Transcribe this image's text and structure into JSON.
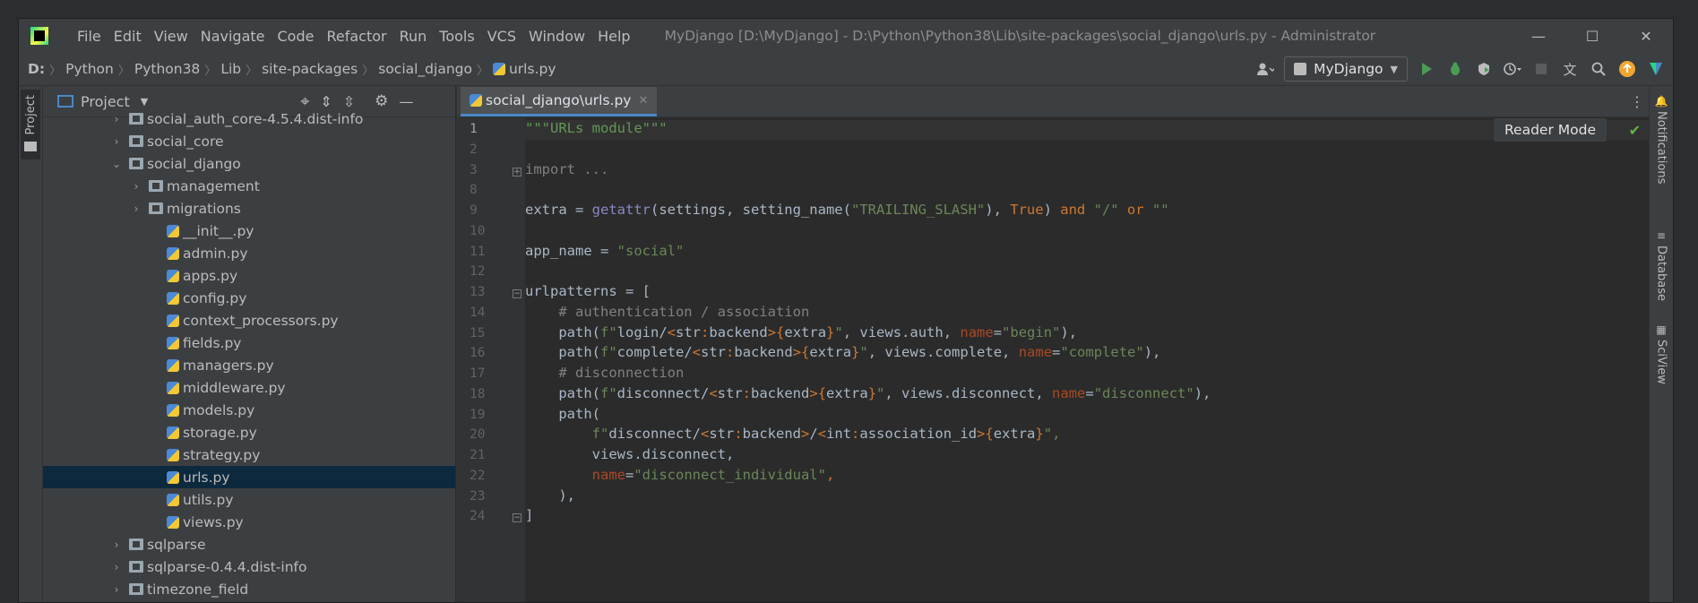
{
  "titlebar": {
    "menu": [
      "File",
      "Edit",
      "View",
      "Navigate",
      "Code",
      "Refactor",
      "Run",
      "Tools",
      "VCS",
      "Window",
      "Help"
    ],
    "window_title": "MyDjango [D:\\MyDjango] - D:\\Python\\Python38\\Lib\\site-packages\\social_django\\urls.py - Administrator",
    "minimize": "—",
    "maximize": "☐",
    "close": "✕"
  },
  "navbar": {
    "crumbs": [
      "D:",
      "Python",
      "Python38",
      "Lib",
      "site-packages",
      "social_django",
      "urls.py"
    ],
    "separator": "〉",
    "run_config": "MyDjango"
  },
  "left_strip": {
    "project_tab": "Project"
  },
  "right_strip": {
    "notifications": "Notifications",
    "database": "Database",
    "sciview": "SciView"
  },
  "project_panel": {
    "title": "Project",
    "tree": [
      {
        "label": "social_auth_core-4.5.4.dist-info",
        "type": "folder",
        "expand": "›"
      },
      {
        "label": "social_core",
        "type": "folder",
        "expand": "›"
      },
      {
        "label": "social_django",
        "type": "folder",
        "expand": "⌄"
      },
      {
        "label": "management",
        "type": "folder",
        "expand": "›"
      },
      {
        "label": "migrations",
        "type": "folder",
        "expand": "›"
      },
      {
        "label": "__init__.py",
        "type": "py"
      },
      {
        "label": "admin.py",
        "type": "py"
      },
      {
        "label": "apps.py",
        "type": "py"
      },
      {
        "label": "config.py",
        "type": "py"
      },
      {
        "label": "context_processors.py",
        "type": "py"
      },
      {
        "label": "fields.py",
        "type": "py"
      },
      {
        "label": "managers.py",
        "type": "py"
      },
      {
        "label": "middleware.py",
        "type": "py"
      },
      {
        "label": "models.py",
        "type": "py"
      },
      {
        "label": "storage.py",
        "type": "py"
      },
      {
        "label": "strategy.py",
        "type": "py"
      },
      {
        "label": "urls.py",
        "type": "py",
        "selected": true
      },
      {
        "label": "utils.py",
        "type": "py"
      },
      {
        "label": "views.py",
        "type": "py"
      },
      {
        "label": "sqlparse",
        "type": "folder",
        "expand": "›"
      },
      {
        "label": "sqlparse-0.4.4.dist-info",
        "type": "folder",
        "expand": "›"
      },
      {
        "label": "timezone_field",
        "type": "folder",
        "expand": "›"
      }
    ]
  },
  "editor": {
    "tab_label": "social_django\\urls.py",
    "tab_close": "✕",
    "reader_mode": "Reader Mode",
    "lines": [
      {
        "num": "1",
        "segments": [
          [
            "\"\"\"URLs module\"\"\"",
            "#629755"
          ]
        ]
      },
      {
        "num": "2",
        "segments": []
      },
      {
        "num": "3",
        "segments": [
          [
            "import ...",
            "#808080"
          ]
        ]
      },
      {
        "num": "8",
        "segments": []
      },
      {
        "num": "9",
        "segments": [
          [
            "extra = ",
            "#a9b7c6"
          ],
          [
            "getattr",
            "#8888c6"
          ],
          [
            "(settings, setting_name(",
            "#a9b7c6"
          ],
          [
            "\"TRAILING_SLASH\"",
            "#6a8759"
          ],
          [
            "), ",
            "#a9b7c6"
          ],
          [
            "True",
            "#cc7832"
          ],
          [
            ") ",
            "#a9b7c6"
          ],
          [
            "and ",
            "#cc7832"
          ],
          [
            "\"/\" ",
            "#6a8759"
          ],
          [
            "or ",
            "#cc7832"
          ],
          [
            "\"\"",
            "#6a8759"
          ]
        ]
      },
      {
        "num": "10",
        "segments": []
      },
      {
        "num": "11",
        "segments": [
          [
            "app_name = ",
            "#a9b7c6"
          ],
          [
            "\"social\"",
            "#6a8759"
          ]
        ]
      },
      {
        "num": "12",
        "segments": []
      },
      {
        "num": "13",
        "segments": [
          [
            "urlpatterns = [",
            "#a9b7c6"
          ]
        ]
      },
      {
        "num": "14",
        "segments": [
          [
            "    # authentication / association",
            "#808080"
          ]
        ]
      },
      {
        "num": "15",
        "segments": [
          [
            "    path(",
            "#a9b7c6"
          ],
          [
            "f\"",
            "#6a8759"
          ],
          [
            "login/",
            "#a9b7c6"
          ],
          [
            "<",
            "#cc7832"
          ],
          [
            "str",
            "#a9b7c6"
          ],
          [
            ":",
            "#cc7832"
          ],
          [
            "backend",
            "#a9b7c6"
          ],
          [
            ">",
            "#cc7832"
          ],
          [
            "{",
            "#cc7832"
          ],
          [
            "extra",
            "#a9b7c6"
          ],
          [
            "}",
            "#cc7832"
          ],
          [
            "\"",
            "#6a8759"
          ],
          [
            ", views.auth, ",
            "#a9b7c6"
          ],
          [
            "name",
            "#aa4926"
          ],
          [
            "=",
            "#a9b7c6"
          ],
          [
            "\"begin\"",
            "#6a8759"
          ],
          [
            "),",
            "#a9b7c6"
          ]
        ]
      },
      {
        "num": "16",
        "segments": [
          [
            "    path(",
            "#a9b7c6"
          ],
          [
            "f\"",
            "#6a8759"
          ],
          [
            "complete/",
            "#a9b7c6"
          ],
          [
            "<",
            "#cc7832"
          ],
          [
            "str",
            "#a9b7c6"
          ],
          [
            ":",
            "#cc7832"
          ],
          [
            "backend",
            "#a9b7c6"
          ],
          [
            ">",
            "#cc7832"
          ],
          [
            "{",
            "#cc7832"
          ],
          [
            "extra",
            "#a9b7c6"
          ],
          [
            "}",
            "#cc7832"
          ],
          [
            "\"",
            "#6a8759"
          ],
          [
            ", views.complete, ",
            "#a9b7c6"
          ],
          [
            "name",
            "#aa4926"
          ],
          [
            "=",
            "#a9b7c6"
          ],
          [
            "\"complete\"",
            "#6a8759"
          ],
          [
            "),",
            "#a9b7c6"
          ]
        ]
      },
      {
        "num": "17",
        "segments": [
          [
            "    # disconnection",
            "#808080"
          ]
        ]
      },
      {
        "num": "18",
        "segments": [
          [
            "    path(",
            "#a9b7c6"
          ],
          [
            "f\"",
            "#6a8759"
          ],
          [
            "disconnect/",
            "#a9b7c6"
          ],
          [
            "<",
            "#cc7832"
          ],
          [
            "str",
            "#a9b7c6"
          ],
          [
            ":",
            "#cc7832"
          ],
          [
            "backend",
            "#a9b7c6"
          ],
          [
            ">",
            "#cc7832"
          ],
          [
            "{",
            "#cc7832"
          ],
          [
            "extra",
            "#a9b7c6"
          ],
          [
            "}",
            "#cc7832"
          ],
          [
            "\"",
            "#6a8759"
          ],
          [
            ", views.disconnect, ",
            "#a9b7c6"
          ],
          [
            "name",
            "#aa4926"
          ],
          [
            "=",
            "#a9b7c6"
          ],
          [
            "\"disconnect\"",
            "#6a8759"
          ],
          [
            "),",
            "#a9b7c6"
          ]
        ]
      },
      {
        "num": "19",
        "segments": [
          [
            "    path(",
            "#a9b7c6"
          ]
        ]
      },
      {
        "num": "20",
        "segments": [
          [
            "        ",
            "#a9b7c6"
          ],
          [
            "f\"",
            "#6a8759"
          ],
          [
            "disconnect/",
            "#a9b7c6"
          ],
          [
            "<",
            "#cc7832"
          ],
          [
            "str",
            "#a9b7c6"
          ],
          [
            ":",
            "#cc7832"
          ],
          [
            "backend",
            "#a9b7c6"
          ],
          [
            ">",
            "#cc7832"
          ],
          [
            "/",
            "#a9b7c6"
          ],
          [
            "<",
            "#cc7832"
          ],
          [
            "int",
            "#a9b7c6"
          ],
          [
            ":",
            "#cc7832"
          ],
          [
            "association_id",
            "#a9b7c6"
          ],
          [
            ">",
            "#cc7832"
          ],
          [
            "{",
            "#cc7832"
          ],
          [
            "extra",
            "#a9b7c6"
          ],
          [
            "}",
            "#cc7832"
          ],
          [
            "\",",
            "#6a8759"
          ]
        ]
      },
      {
        "num": "21",
        "segments": [
          [
            "        views.disconnect,",
            "#a9b7c6"
          ]
        ]
      },
      {
        "num": "22",
        "segments": [
          [
            "        ",
            "#a9b7c6"
          ],
          [
            "name",
            "#aa4926"
          ],
          [
            "=",
            "#a9b7c6"
          ],
          [
            "\"disconnect_individual\"",
            "#6a8759"
          ],
          [
            ",",
            "#cc7832"
          ]
        ]
      },
      {
        "num": "23",
        "segments": [
          [
            "    ),",
            "#a9b7c6"
          ]
        ]
      },
      {
        "num": "24",
        "segments": [
          [
            "]",
            "#a9b7c6"
          ]
        ]
      }
    ]
  },
  "colors": {
    "accent": "#4a88c7",
    "selection": "#0d293e",
    "run_green": "#499c54",
    "update_orange": "#f0a732"
  }
}
